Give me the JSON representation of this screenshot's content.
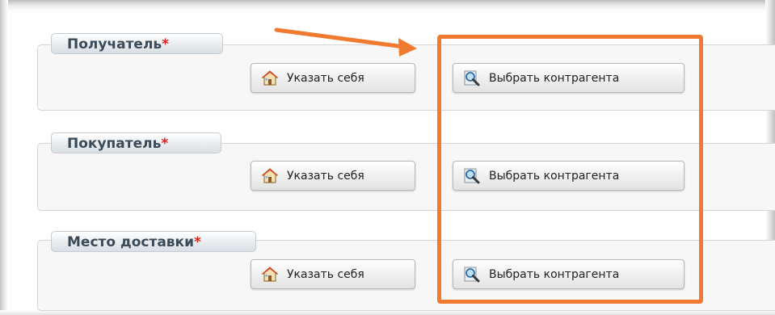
{
  "colors": {
    "accent_highlight": "#f07a2f",
    "required_marker": "#e0201b",
    "legend_text": "#3a4a58"
  },
  "groups": [
    {
      "title": "Получатель",
      "required": "*",
      "self_button": {
        "label": "Указать себя",
        "icon": "house-icon"
      },
      "agent_button": {
        "label": "Выбрать контрагента",
        "icon": "magnifier-icon"
      }
    },
    {
      "title": "Покупатель",
      "required": "*",
      "self_button": {
        "label": "Указать себя",
        "icon": "house-icon"
      },
      "agent_button": {
        "label": "Выбрать контрагента",
        "icon": "magnifier-icon"
      }
    },
    {
      "title": "Место доставки",
      "required": "*",
      "self_button": {
        "label": "Указать себя",
        "icon": "house-icon"
      },
      "agent_button": {
        "label": "Выбрать контрагента",
        "icon": "magnifier-icon"
      }
    }
  ],
  "annotations": {
    "arrow": "arrow-annotation",
    "highlight": "highlight-box"
  }
}
